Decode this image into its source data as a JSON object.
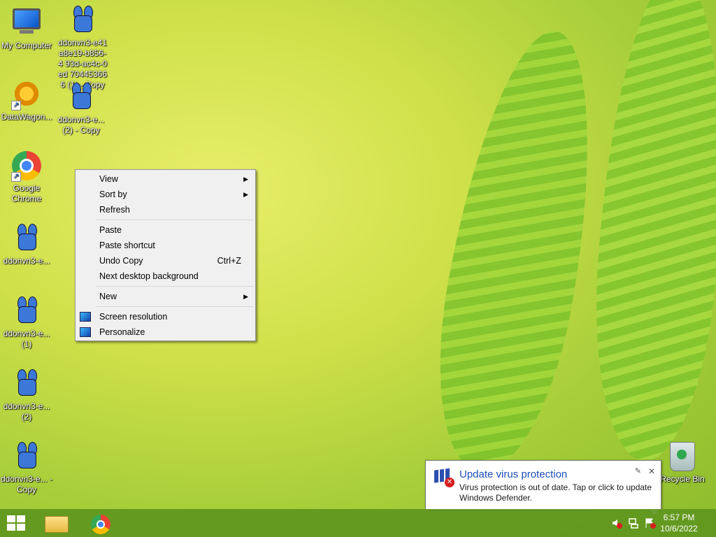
{
  "desktop": {
    "icons": [
      {
        "label": "My Computer"
      },
      {
        "label": "ddonvn3-e41 a8e19-b856-4 93d-ac4c-0ed 704453666 (1) - Copy"
      },
      {
        "label": "DataWagon..."
      },
      {
        "label": "ddonvn3-e... (2) - Copy"
      },
      {
        "label": "Google Chrome"
      },
      {
        "label": "ddonvn3-e..."
      },
      {
        "label": "ddonvn3-e... (1)"
      },
      {
        "label": "ddonvn3-e... (2)"
      },
      {
        "label": "ddonvn3-e... - Copy"
      },
      {
        "label": "Recycle Bin"
      }
    ]
  },
  "context_menu": {
    "items": [
      {
        "label": "View",
        "submenu": true
      },
      {
        "label": "Sort by",
        "submenu": true
      },
      {
        "label": "Refresh"
      },
      {
        "label": "Paste"
      },
      {
        "label": "Paste shortcut"
      },
      {
        "label": "Undo Copy",
        "shortcut": "Ctrl+Z"
      },
      {
        "label": "Next desktop background"
      },
      {
        "label": "New",
        "submenu": true
      },
      {
        "label": "Screen resolution",
        "icon": "monitor-icon"
      },
      {
        "label": "Personalize",
        "icon": "personalize-icon"
      }
    ]
  },
  "notification": {
    "title": "Update virus protection",
    "body": "Virus protection is out of date. Tap or click to update Windows Defender.",
    "close_glyph": "✕",
    "pin_glyph": "✎"
  },
  "taskbar": {
    "time": "6:57 PM",
    "date": "10/6/2022",
    "pinned": [
      "file-explorer-icon",
      "chrome-icon"
    ]
  },
  "colors": {
    "taskbar": "#6a9a1e",
    "notification_title": "#1c4fb8",
    "menu_bg": "#f0f0f0"
  }
}
